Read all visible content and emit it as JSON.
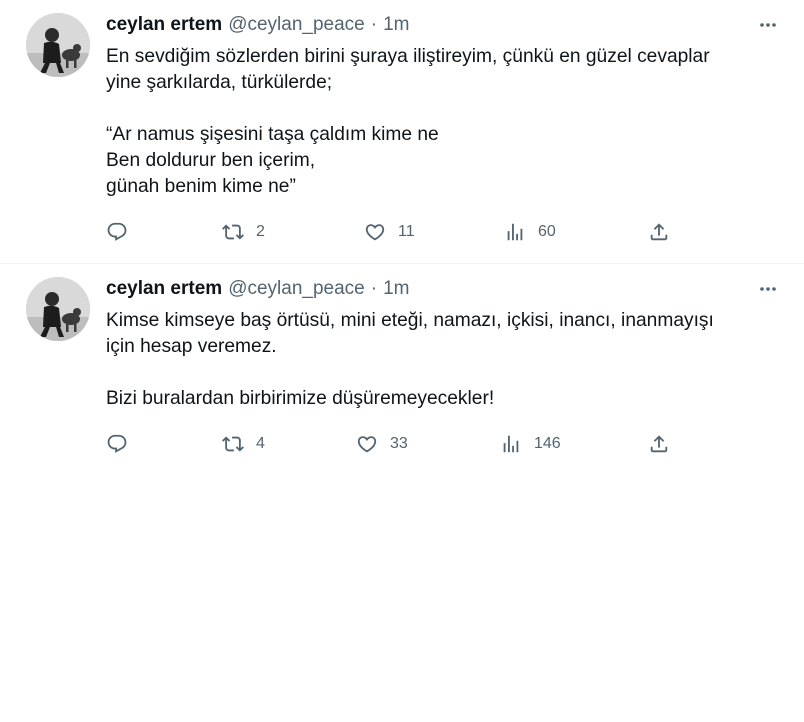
{
  "tweets": [
    {
      "author_name": "ceylan ertem",
      "handle": "@ceylan_peace",
      "separator": "·",
      "time": "1m",
      "lines": [
        "En sevdiğim sözlerden birini şuraya iliştireyim, çünkü en güzel cevaplar",
        "yine şarkılarda, türkülerde;",
        "",
        "“Ar namus şişesini taşa çaldım kime ne",
        "Ben doldurur ben içerim,",
        "günah benim kime ne”"
      ],
      "reply_count": "",
      "retweet_count": "2",
      "like_count": "11",
      "view_count": "60"
    },
    {
      "author_name": "ceylan ertem",
      "handle": "@ceylan_peace",
      "separator": "·",
      "time": "1m",
      "lines": [
        "Kimse kimseye baş örtüsü, mini eteği, namazı, içkisi, inancı, inanmayışı",
        "için hesap veremez.",
        "",
        "Bizi buralardan birbirimize düşüremeyecekler!"
      ],
      "reply_count": "",
      "retweet_count": "4",
      "like_count": "33",
      "view_count": "146"
    }
  ],
  "icons": {
    "reply": "reply-icon",
    "retweet": "retweet-icon",
    "like": "heart-icon",
    "views": "views-icon",
    "share": "share-icon",
    "more": "more-icon"
  },
  "colors": {
    "text": "#0f1419",
    "muted": "#536471",
    "divider": "#eff3f4"
  }
}
